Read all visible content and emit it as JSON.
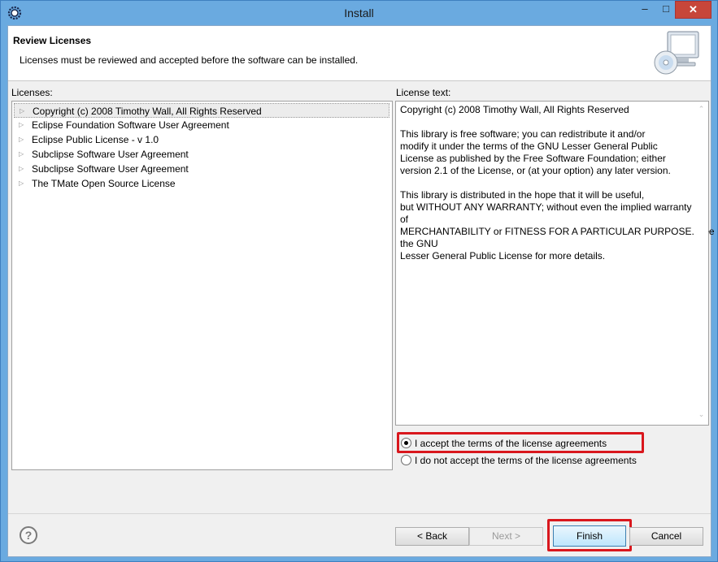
{
  "window": {
    "title": "Install",
    "minimize_glyph": "–",
    "maximize_glyph": "□",
    "close_glyph": "✕",
    "icon": "eclipse-gear-icon"
  },
  "banner": {
    "title": "Review Licenses",
    "description": "Licenses must be reviewed and accepted before the software can be installed.",
    "image": "computer-cd-icon"
  },
  "licenses_panel": {
    "label": "Licenses:",
    "items": [
      {
        "label": "Copyright (c) 2008 Timothy Wall, All Rights Reserved",
        "selected": true
      },
      {
        "label": "Eclipse Foundation Software User Agreement",
        "selected": false
      },
      {
        "label": "Eclipse Public License - v 1.0",
        "selected": false
      },
      {
        "label": "Subclipse Software User Agreement",
        "selected": false
      },
      {
        "label": "Subclipse Software User Agreement",
        "selected": false
      },
      {
        "label": "The TMate Open Source License",
        "selected": false
      }
    ],
    "expand_glyph": "▷"
  },
  "license_text_panel": {
    "label": "License text:",
    "lines": [
      "Copyright (c) 2008 Timothy Wall, All Rights Reserved",
      "",
      "This library is free software; you can redistribute it and/or",
      "modify it under the terms of the GNU Lesser General Public",
      "License as published by the Free Software Foundation; either",
      "version 2.1 of the License, or (at your option) any later version.",
      "",
      "This library is distributed in the hope that it will be useful,",
      "but WITHOUT ANY WARRANTY; without even the implied warranty",
      "of",
      "MERCHANTABILITY or FITNESS FOR A PARTICULAR PURPOSE.  See",
      "the GNU",
      "Lesser General Public License for more details."
    ],
    "scroll_up_glyph": "⌃",
    "scroll_down_glyph": "⌄"
  },
  "accept_options": {
    "accept_label": "I accept the terms of the license agreements",
    "decline_label": "I do not accept the terms of the license agreements",
    "selected": "accept"
  },
  "buttons": {
    "help_glyph": "?",
    "back": "< Back",
    "next": "Next >",
    "finish": "Finish",
    "cancel": "Cancel"
  },
  "colors": {
    "title_bar": "#6aaae0",
    "close_button": "#c7463a",
    "highlight_box": "#d9171d"
  }
}
